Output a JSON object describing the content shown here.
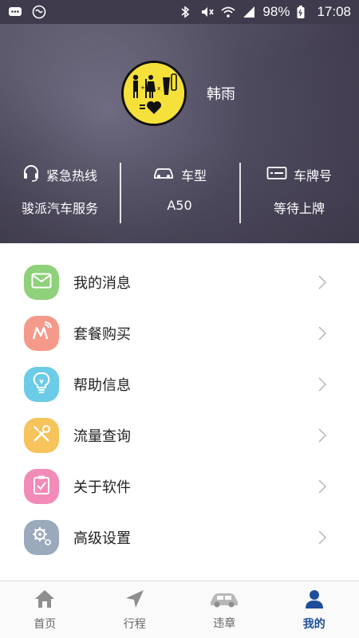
{
  "status_bar": {
    "battery": "98%",
    "time": "17:08"
  },
  "header": {
    "user_name": "韩雨",
    "info": [
      {
        "title": "紧急热线",
        "value": "骏派汽车服务",
        "icon": "headset-icon"
      },
      {
        "title": "车型",
        "value": "A50",
        "icon": "car-icon"
      },
      {
        "title": "车牌号",
        "value": "等待上牌",
        "icon": "license-plate-icon"
      }
    ]
  },
  "menu": {
    "items": [
      {
        "label": "我的消息",
        "icon": "mail-icon",
        "color": "#8fd07a"
      },
      {
        "label": "套餐购买",
        "icon": "package-icon",
        "color": "#f59a8a"
      },
      {
        "label": "帮助信息",
        "icon": "lightbulb-icon",
        "color": "#6ccbe6"
      },
      {
        "label": "流量查询",
        "icon": "tools-icon",
        "color": "#f7c35b"
      },
      {
        "label": "关于软件",
        "icon": "clipboard-icon",
        "color": "#f28bb8"
      },
      {
        "label": "高级设置",
        "icon": "gear-icon",
        "color": "#9aa9bb"
      }
    ]
  },
  "nav": {
    "items": [
      {
        "label": "首页",
        "icon": "home-icon"
      },
      {
        "label": "行程",
        "icon": "navigation-icon"
      },
      {
        "label": "违章",
        "icon": "car-icon"
      },
      {
        "label": "我的",
        "icon": "person-icon",
        "active": true
      }
    ]
  },
  "colors": {
    "accent": "#1e4e9a",
    "header_bg": "#4e4a5e"
  }
}
